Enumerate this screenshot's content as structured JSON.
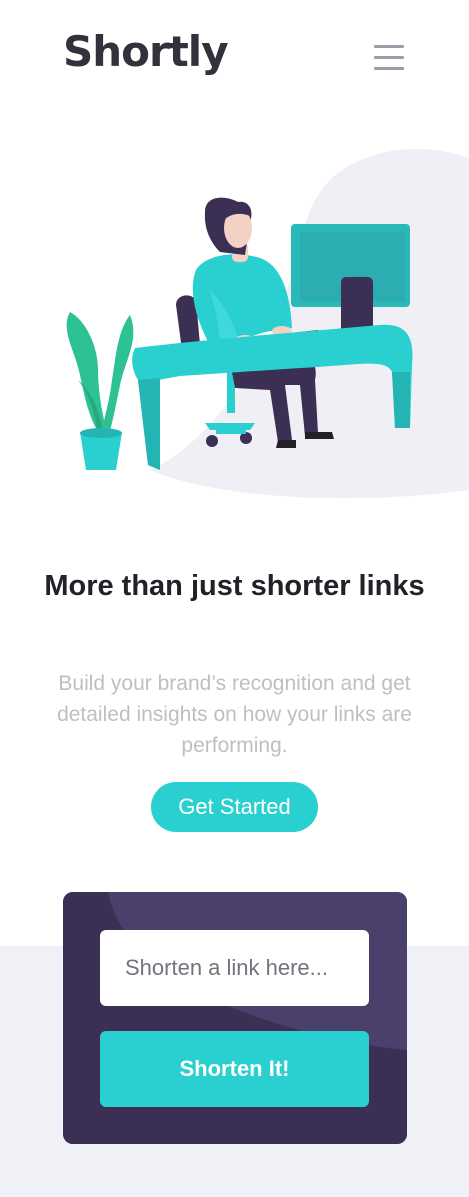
{
  "header": {
    "logo_text": "Shortly",
    "menu_icon": "hamburger-menu-icon"
  },
  "hero": {
    "illustration": "person-working-at-desk-illustration",
    "headline": "More than just shorter links",
    "subtext": "Build your brand’s recognition and get detailed insights on how your links are performing.",
    "cta_label": "Get Started"
  },
  "shorten": {
    "placeholder": "Shorten a link here...",
    "value": "",
    "button_label": "Shorten It!"
  },
  "colors": {
    "primary_cyan": "#2acfcf",
    "dark_violet": "#3b3054",
    "heading_dark": "#232127",
    "gray_text": "#bfbfbf",
    "light_bg": "#f0f1f6"
  }
}
